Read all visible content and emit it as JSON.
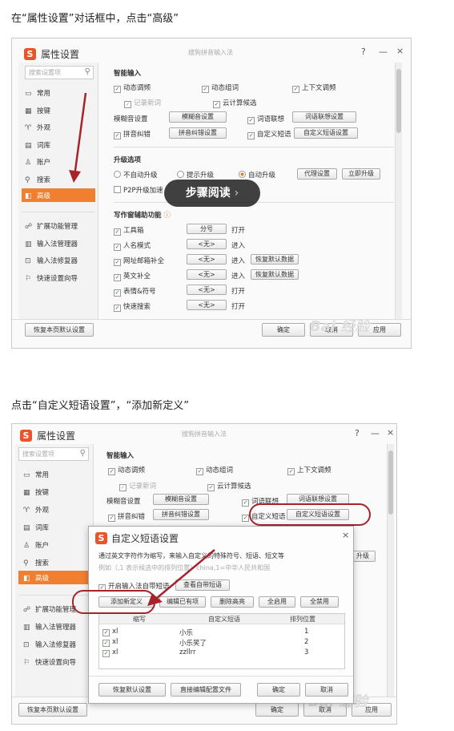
{
  "step1": {
    "caption": "在“属性设置”对话框中，点击“高级”",
    "window": {
      "title": "属性设置",
      "subtitle": "搜狗拼音输入法",
      "controls": {
        "help": "?",
        "minimize": "—",
        "close": "×"
      },
      "search_placeholder": "搜索设置项",
      "nav": [
        {
          "label": "常用",
          "icon": "monitor-icon"
        },
        {
          "label": "按键",
          "icon": "keyboard-icon"
        },
        {
          "label": "外观",
          "icon": "shirt-icon"
        },
        {
          "label": "词库",
          "icon": "book-icon"
        },
        {
          "label": "账户",
          "icon": "user-icon"
        },
        {
          "label": "搜索",
          "icon": "search-icon"
        },
        {
          "label": "高级",
          "icon": "advanced-icon",
          "active": true
        }
      ],
      "nav2": [
        {
          "label": "扩展功能管理",
          "icon": "extension-icon"
        },
        {
          "label": "输入法管理器",
          "icon": "manager-icon"
        },
        {
          "label": "输入法修复器",
          "icon": "repair-icon"
        },
        {
          "label": "快速设置向导",
          "icon": "flag-icon"
        }
      ],
      "smart_input": {
        "title": "智能输入",
        "dynamic_freq": "动态调频",
        "dynamic_word": "动态组词",
        "context_freq": "上下文调频",
        "record_new": "记录新词",
        "cloud_candidate": "云计算候选",
        "fuzzy": "模糊音设置",
        "fuzzy_btn": "模糊音设置",
        "assoc": "词语联想",
        "assoc_btn": "词语联想设置",
        "pinyin_correct": "拼音纠错",
        "pinyin_btn": "拼音纠错设置",
        "custom_phrase": "自定义短语",
        "custom_btn": "自定义短语设置"
      },
      "upgrade": {
        "title": "升级选项",
        "no_auto": "不自动升级",
        "prompt": "提示升级",
        "auto": "自动升级",
        "proxy_btn": "代理设置",
        "now_btn": "立即升级",
        "p2p": "P2P升级加速"
      },
      "writing": {
        "title": "写作窗辅助功能",
        "rows": [
          {
            "label": "工具箱",
            "key": "分号",
            "action": "打开"
          },
          {
            "label": "人名模式",
            "key": "<无>",
            "action": "进入"
          },
          {
            "label": "网址邮箱补全",
            "key": "<无>",
            "action": "进入",
            "extra": "恢复默认数据"
          },
          {
            "label": "英文补全",
            "key": "<无>",
            "action": "进入",
            "extra": "恢复默认数据"
          },
          {
            "label": "表情&符号",
            "key": "<无>",
            "action": "打开"
          },
          {
            "label": "快速搜索",
            "key": "<无>",
            "action": "打开"
          }
        ]
      },
      "footer": {
        "restore": "恢复本页默认设置",
        "ok": "确定",
        "cancel": "取消",
        "apply": "应用"
      }
    },
    "overlay_badge": "步骤阅读",
    "badge_arrow": "›"
  },
  "step2": {
    "caption": "点击“自定义短语设置”，“添加新定义”",
    "upgrade_btn_partial": "升级",
    "dialog": {
      "title": "自定义短语设置",
      "close": "×",
      "desc": "通过英文字符作为缩写，来输入自定义的特殊符号、短语、短文等",
      "example": "例如（,1 表示候选中的排列位置）china,1=中华人民共和国",
      "enable_label": "开启输入法自带短语",
      "view_btn": "查看自带短语",
      "buttons": {
        "add": "添加新定义",
        "edit": "编辑已有项",
        "delete": "删除高亮",
        "enable_all": "全启用",
        "disable_all": "全禁用"
      },
      "columns": [
        "缩写",
        "自定义短语",
        "排列位置"
      ],
      "rows": [
        {
          "abbr": "xl",
          "phrase": "小乐",
          "pos": "1"
        },
        {
          "abbr": "xl",
          "phrase": "小乐笑了",
          "pos": "2"
        },
        {
          "abbr": "xl",
          "phrase": "zzllrr",
          "pos": "3"
        }
      ],
      "footer": {
        "restore": "恢复默认设置",
        "edit_file": "直接编辑配置文件",
        "ok": "确定",
        "cancel": "取消"
      }
    }
  },
  "watermark": "Bai 经验"
}
